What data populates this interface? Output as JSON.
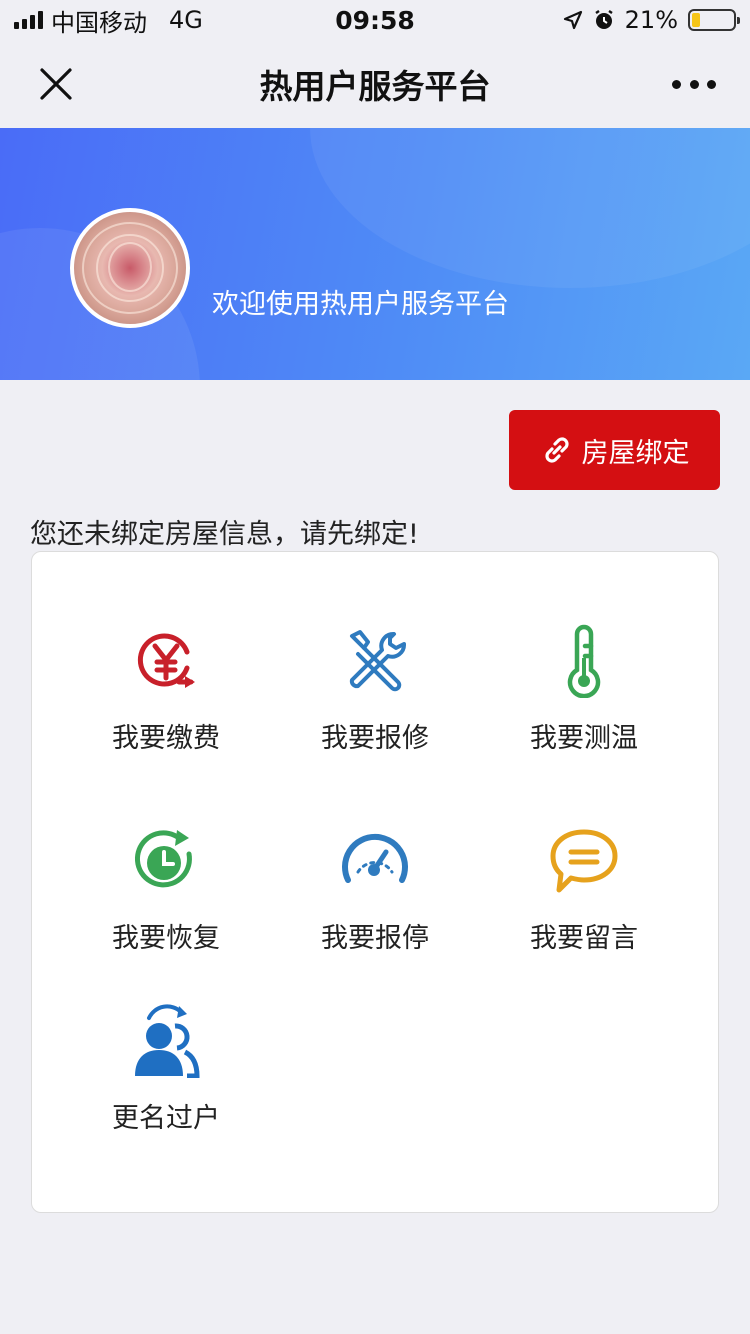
{
  "status_bar": {
    "carrier": "中国移动",
    "network": "4G",
    "time": "09:58",
    "battery": "21%",
    "battery_level": 0.21
  },
  "nav": {
    "title": "热用户服务平台"
  },
  "banner": {
    "welcome": "欢迎使用热用户服务平台"
  },
  "bind_button": {
    "label": "房屋绑定"
  },
  "notice": "您还未绑定房屋信息，请先绑定!",
  "services": [
    {
      "label": "我要缴费",
      "icon": "yuan-payment-icon",
      "color": "#c8202a"
    },
    {
      "label": "我要报修",
      "icon": "repair-tools-icon",
      "color": "#2f7bbf"
    },
    {
      "label": "我要测温",
      "icon": "thermometer-icon",
      "color": "#3aa655"
    },
    {
      "label": "我要恢复",
      "icon": "restore-clock-icon",
      "color": "#3aa655"
    },
    {
      "label": "我要报停",
      "icon": "speedometer-icon",
      "color": "#2f7bbf"
    },
    {
      "label": "我要留言",
      "icon": "message-bubble-icon",
      "color": "#e6a21d"
    },
    {
      "label": "更名过户",
      "icon": "transfer-users-icon",
      "color": "#1f6fc2"
    }
  ]
}
